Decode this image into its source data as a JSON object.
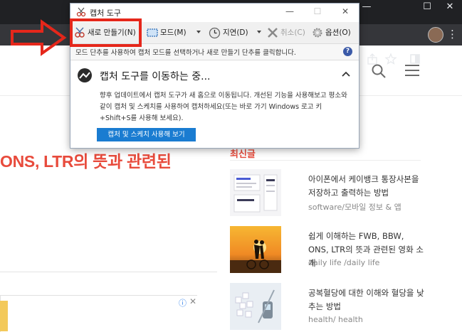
{
  "browser": {
    "window_controls": {
      "minimize": "—",
      "maximize": "☐",
      "close": "✕"
    },
    "toolbar_icons": [
      "share-icon",
      "star-icon",
      "sidebar-icon",
      "avatar",
      "more-icon"
    ]
  },
  "site": {
    "headline": "ONS, LTR의 뜻과 관련된",
    "recent_title": "최신글",
    "posts": [
      {
        "title": "아이폰에서 케이뱅크 통장사본을 저장하고 출력하는 방법",
        "category": "software/모바일 정보 & 앱"
      },
      {
        "title": "쉽게 이해하는 FWB, BBW, ONS, LTR의 뜻과 관련된 영화 소개",
        "category": "daily life /daily life"
      },
      {
        "title": "공복혈당에 대한 이해와 혈당을 낮추는 방법",
        "category": "health/ health"
      }
    ]
  },
  "snipping_tool": {
    "title": "캡처 도구",
    "toolbar": {
      "new": "새로 만들기(N)",
      "mode": "모드(M)",
      "delay": "지연(D)",
      "cancel": "취소(C)",
      "options": "옵션(O)"
    },
    "hint": "모드 단추를 사용하여 캡처 모드를 선택하거나 새로 만들기 단추를 클릭합니다.",
    "move_title": "캡처 도구를 이동하는 중...",
    "move_desc": "향후 업데이트에서 캡처 도구가 새 홈으로 이동됩니다. 개선된 기능을 사용해보고 평소와 같이 캡처 및 스케치를 사용하여 캡처하세요(또는 바로 가기 Windows 로고 키+Shift+S를 사용해 보세요).",
    "try_button": "캡처 및 스케치 사용해 보기"
  },
  "colors": {
    "accent_red": "#e84b3c",
    "highlight_red": "#e5271b",
    "button_blue": "#1a7cd1"
  }
}
